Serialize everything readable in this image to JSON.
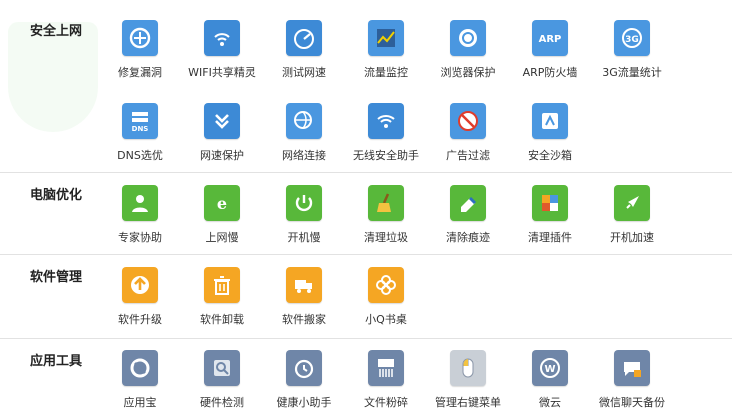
{
  "sections": [
    {
      "title": "安全上网",
      "rows": [
        [
          {
            "label": "修复漏洞",
            "icon": "repair-icon",
            "color": "#4a97e0"
          },
          {
            "label": "WIFI共享精灵",
            "icon": "wifi-share-icon",
            "color": "#3d8ad6"
          },
          {
            "label": "测试网速",
            "icon": "speedometer-icon",
            "color": "#3d8ad6"
          },
          {
            "label": "流量监控",
            "icon": "traffic-chart-icon",
            "color": "#4a97e0"
          },
          {
            "label": "浏览器保护",
            "icon": "browser-protect-icon",
            "color": "#4a97e0"
          },
          {
            "label": "ARP防火墙",
            "icon": "arp-firewall-icon",
            "color": "#4a97e0"
          },
          {
            "label": "3G流量统计",
            "icon": "3g-icon",
            "color": "#4a97e0"
          }
        ],
        [
          {
            "label": "DNS选优",
            "icon": "dns-icon",
            "color": "#4a97e0"
          },
          {
            "label": "网速保护",
            "icon": "double-chevron-icon",
            "color": "#3d8ad6"
          },
          {
            "label": "网络连接",
            "icon": "globe-link-icon",
            "color": "#4a97e0"
          },
          {
            "label": "无线安全助手",
            "icon": "wifi-shield-icon",
            "color": "#3d8ad6"
          },
          {
            "label": "广告过滤",
            "icon": "ad-block-icon",
            "color": "#4a97e0"
          },
          {
            "label": "安全沙箱",
            "icon": "sandbox-icon",
            "color": "#4a97e0"
          }
        ]
      ]
    },
    {
      "title": "电脑优化",
      "rows": [
        [
          {
            "label": "专家协助",
            "icon": "expert-icon",
            "color": "#58b83a"
          },
          {
            "label": "上网慢",
            "icon": "ie-slow-icon",
            "color": "#58b83a"
          },
          {
            "label": "开机慢",
            "icon": "power-slow-icon",
            "color": "#58b83a"
          },
          {
            "label": "清理垃圾",
            "icon": "broom-icon",
            "color": "#58b83a"
          },
          {
            "label": "清除痕迹",
            "icon": "eraser-icon",
            "color": "#58b83a"
          },
          {
            "label": "清理插件",
            "icon": "puzzle-icon",
            "color": "#58b83a"
          },
          {
            "label": "开机加速",
            "icon": "rocket-icon",
            "color": "#58b83a"
          }
        ]
      ]
    },
    {
      "title": "软件管理",
      "rows": [
        [
          {
            "label": "软件升级",
            "icon": "upgrade-arrow-icon",
            "color": "#f5a623"
          },
          {
            "label": "软件卸载",
            "icon": "trash-icon",
            "color": "#f5a623"
          },
          {
            "label": "软件搬家",
            "icon": "truck-icon",
            "color": "#f5a623"
          },
          {
            "label": "小Q书桌",
            "icon": "flower-icon",
            "color": "#f5a623"
          }
        ]
      ]
    },
    {
      "title": "应用工具",
      "rows": [
        [
          {
            "label": "应用宝",
            "icon": "app-store-icon",
            "color": "#6f86a8"
          },
          {
            "label": "硬件检测",
            "icon": "magnifier-icon",
            "color": "#6f86a8"
          },
          {
            "label": "健康小助手",
            "icon": "alarm-clock-icon",
            "color": "#6f86a8"
          },
          {
            "label": "文件粉碎",
            "icon": "shredder-icon",
            "color": "#6f86a8"
          },
          {
            "label": "管理右键菜单",
            "icon": "mouse-icon",
            "color": "#c9cfd6"
          },
          {
            "label": "微云",
            "icon": "cloud-icon",
            "color": "#6f86a8"
          },
          {
            "label": "微信聊天备份",
            "icon": "chat-backup-icon",
            "color": "#6f86a8"
          }
        ]
      ]
    }
  ]
}
